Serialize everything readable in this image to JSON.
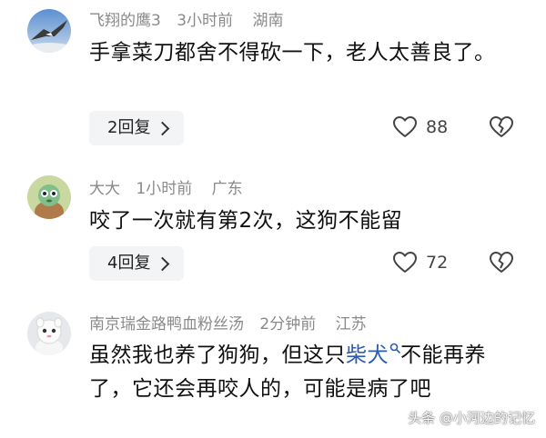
{
  "comments": [
    {
      "user": "飞翔的鹰3",
      "time": "3小时前",
      "location": "湖南",
      "text": "手拿菜刀都舍不得砍一下，老人太善良了。",
      "reply_label": "2回复",
      "likes": "88",
      "avatar_icon": "eagle-avatar"
    },
    {
      "user": "大大",
      "time": "1小时前",
      "location": "广东",
      "text": "咬了一次就有第2次，这狗不能留",
      "reply_label": "4回复",
      "likes": "72",
      "avatar_icon": "cartoon-avatar"
    },
    {
      "user": "南京瑞金路鸭血粉丝汤",
      "time": "2分钟前",
      "location": "江苏",
      "text_before": "虽然我也养了狗狗，但这只",
      "tag": "柴犬",
      "text_after": "不能再养了，它还会再咬人的，可能是病了吧",
      "avatar_icon": "plush-toy-avatar"
    }
  ],
  "watermark": "头条 @小河边的记忆",
  "colors": {
    "meta": "#8a8a8a",
    "tag": "#2a5db0",
    "reply_bg": "#f3f4f6"
  }
}
